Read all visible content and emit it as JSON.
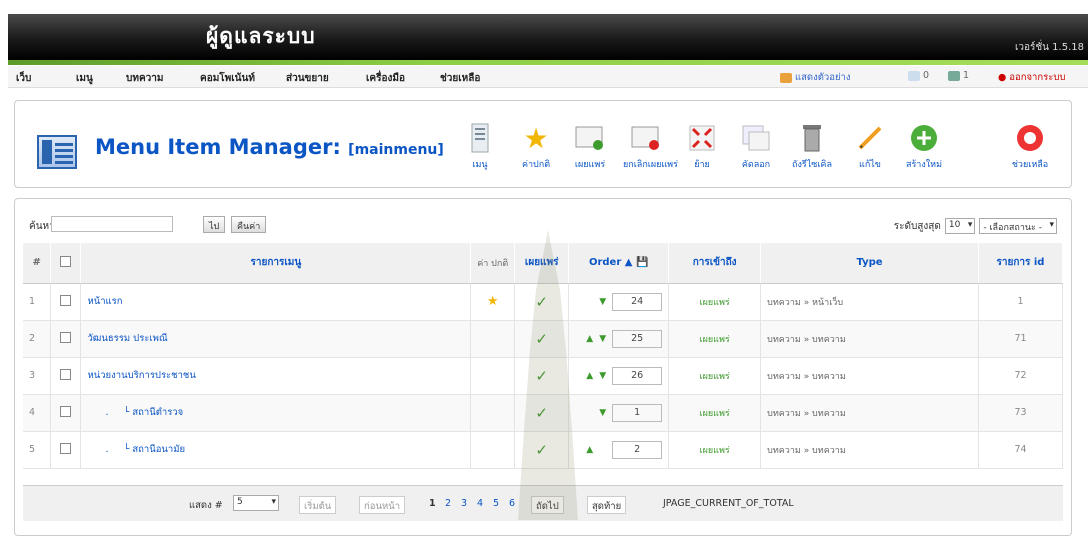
{
  "header": {
    "title": "ผู้ดูแลระบบ",
    "version": "เวอร์ชั่น 1.5.18"
  },
  "menubar": {
    "items": [
      "เว็บ",
      "เมนู",
      "บทความ",
      "คอมโพเน้นท์",
      "ส่วนขยาย",
      "เครื่องมือ",
      "ช่วยเหลือ"
    ],
    "preview": "แสดงตัวอย่าง",
    "messages": "0",
    "users": "1",
    "logout": "ออกจากระบบ"
  },
  "toolbar": {
    "title": "Menu Item Manager:",
    "subtitle": "[mainmenu]",
    "buttons": [
      {
        "label": "เมนู",
        "icon": "menu-icon"
      },
      {
        "label": "ค่าปกติ",
        "icon": "default-star-icon"
      },
      {
        "label": "เผยแพร่",
        "icon": "publish-icon"
      },
      {
        "label": "ยกเลิกเผยแพร่",
        "icon": "unpublish-icon"
      },
      {
        "label": "ย้าย",
        "icon": "move-icon"
      },
      {
        "label": "คัดลอก",
        "icon": "copy-icon"
      },
      {
        "label": "ถังรีไซเคิล",
        "icon": "trash-icon"
      },
      {
        "label": "แก้ไข",
        "icon": "edit-icon"
      },
      {
        "label": "สร้างใหม่",
        "icon": "new-icon"
      },
      {
        "label": "ช่วยเหลือ",
        "icon": "help-icon"
      }
    ]
  },
  "filter": {
    "label": "ค้นหา:",
    "go": "ไป",
    "reset": "คืนค่า",
    "level_label": "ระดับสูงสุด",
    "level_value": "10",
    "state_value": "- เลือกสถานะ -"
  },
  "table": {
    "headers": {
      "num": "#",
      "items": "รายการเมนู",
      "default": "ค่า ปกติ",
      "published": "เผยแพร่",
      "order": "Order",
      "access": "การเข้าถึง",
      "type": "Type",
      "itemid": "รายการ id"
    },
    "rows": [
      {
        "num": "1",
        "name": "หน้าแรก",
        "default": true,
        "order": "24",
        "up": false,
        "down": true,
        "access": "เผยแพร่",
        "type": "บทความ » หน้าเว็บ",
        "id": "1"
      },
      {
        "num": "2",
        "name": "วัฒนธรรม ประเพณี",
        "default": false,
        "order": "25",
        "up": true,
        "down": true,
        "access": "เผยแพร่",
        "type": "บทความ » บทความ",
        "id": "71"
      },
      {
        "num": "3",
        "name": "หน่วยงานบริการประชาชน",
        "default": false,
        "order": "26",
        "up": true,
        "down": true,
        "access": "เผยแพร่",
        "type": "บทความ » บทความ",
        "id": "72"
      },
      {
        "num": "4",
        "name": "สถานีตำรวจ",
        "default": false,
        "order": "1",
        "up": false,
        "down": true,
        "access": "เผยแพร่",
        "type": "บทความ » บทความ",
        "id": "73",
        "indent": true
      },
      {
        "num": "5",
        "name": "สถานีอนามัย",
        "default": false,
        "order": "2",
        "up": true,
        "down": false,
        "access": "เผยแพร่",
        "type": "บทความ » บทความ",
        "id": "74",
        "indent": true
      }
    ]
  },
  "pager": {
    "display_label": "แสดง #",
    "display_value": "5",
    "start": "เริ่มต้น",
    "prev": "ก่อนหน้า",
    "pages": [
      "1",
      "2",
      "3",
      "4",
      "5",
      "6"
    ],
    "next": "ถัดไป",
    "end": "สุดท้าย",
    "status": "JPAGE_CURRENT_OF_TOTAL"
  }
}
